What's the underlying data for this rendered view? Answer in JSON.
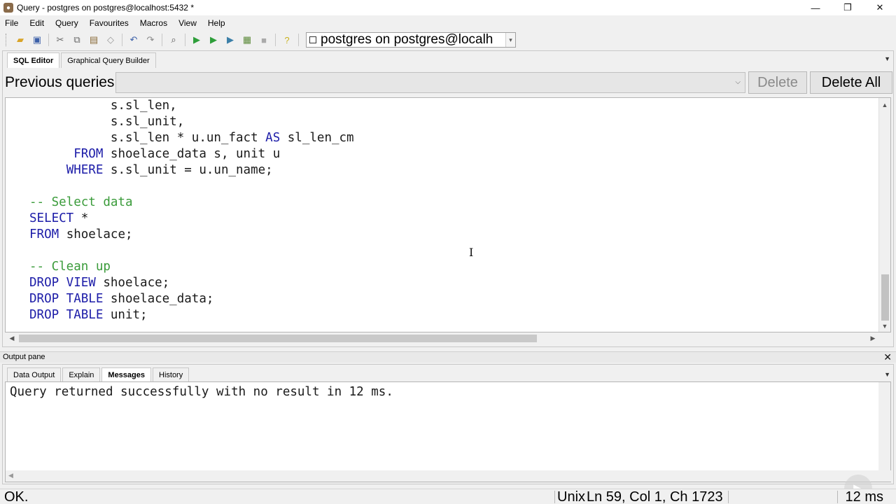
{
  "window": {
    "title": "Query - postgres on postgres@localhost:5432 *"
  },
  "menu": {
    "items": [
      "File",
      "Edit",
      "Query",
      "Favourites",
      "Macros",
      "View",
      "Help"
    ]
  },
  "toolbar": {
    "connection": "postgres on postgres@localh"
  },
  "editor": {
    "tabs": [
      "SQL Editor",
      "Graphical Query Builder"
    ],
    "previous_queries_label": "Previous queries",
    "delete_label": "Delete",
    "delete_all_label": "Delete All",
    "code_lines": [
      [
        {
          "t": "           s.sl_len,",
          "c": "n"
        }
      ],
      [
        {
          "t": "           s.sl_unit,",
          "c": "n"
        }
      ],
      [
        {
          "t": "           s.sl_len * u.un_fact ",
          "c": "n"
        },
        {
          "t": "AS",
          "c": "kw"
        },
        {
          "t": " sl_len_cm",
          "c": "n"
        }
      ],
      [
        {
          "t": "      ",
          "c": "n"
        },
        {
          "t": "FROM",
          "c": "kw"
        },
        {
          "t": " shoelace_data s, unit u",
          "c": "n"
        }
      ],
      [
        {
          "t": "     ",
          "c": "n"
        },
        {
          "t": "WHERE",
          "c": "kw"
        },
        {
          "t": " s.sl_unit = u.un_name;",
          "c": "n"
        }
      ],
      [
        {
          "t": "",
          "c": "n"
        }
      ],
      [
        {
          "t": "-- Select data",
          "c": "cm"
        }
      ],
      [
        {
          "t": "SELECT",
          "c": "kw"
        },
        {
          "t": " *",
          "c": "n"
        }
      ],
      [
        {
          "t": "FROM",
          "c": "kw"
        },
        {
          "t": " shoelace;",
          "c": "n"
        }
      ],
      [
        {
          "t": "",
          "c": "n"
        }
      ],
      [
        {
          "t": "-- Clean up",
          "c": "cm"
        }
      ],
      [
        {
          "t": "DROP VIEW",
          "c": "kw"
        },
        {
          "t": " shoelace;",
          "c": "n"
        }
      ],
      [
        {
          "t": "DROP TABLE",
          "c": "kw"
        },
        {
          "t": " shoelace_data;",
          "c": "n"
        }
      ],
      [
        {
          "t": "DROP TABLE",
          "c": "kw"
        },
        {
          "t": " unit;",
          "c": "n"
        }
      ]
    ]
  },
  "output": {
    "pane_title": "Output pane",
    "tabs": [
      "Data Output",
      "Explain",
      "Messages",
      "History"
    ],
    "active_tab": "Messages",
    "message": "Query returned successfully with no result in 12 ms."
  },
  "status": {
    "state": "OK.",
    "encoding": "Unix",
    "position": "Ln 59, Col 1, Ch 1723",
    "time": "12 ms"
  }
}
